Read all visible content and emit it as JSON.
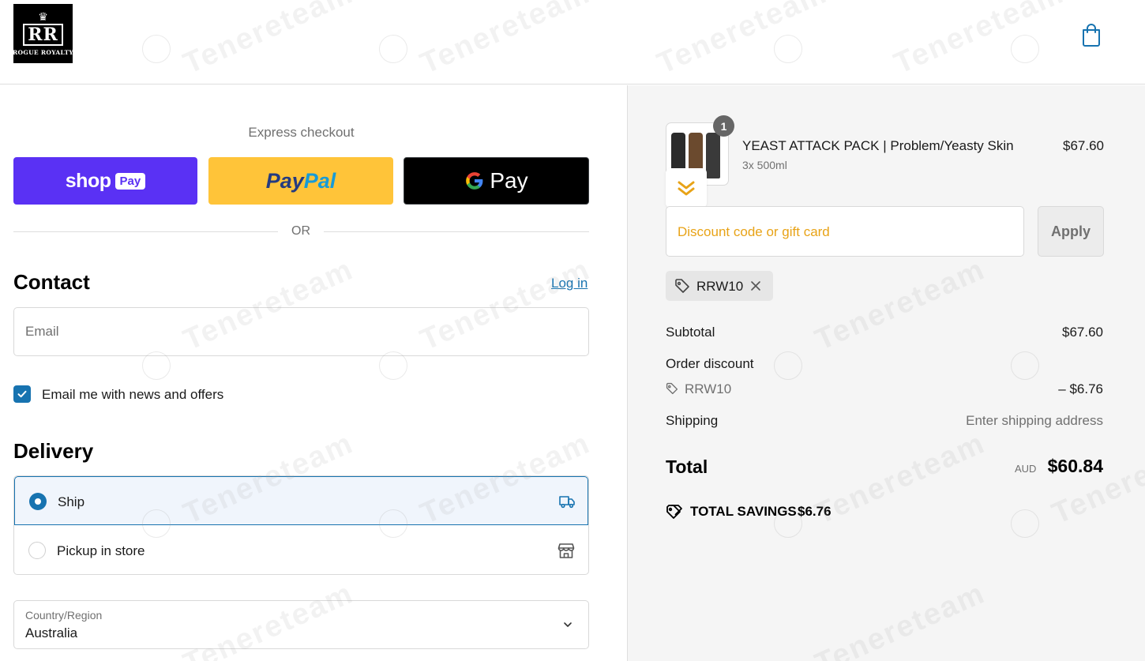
{
  "brand": {
    "logo_monogram": "RR",
    "logo_text": "ROGUE ROYALTY"
  },
  "watermark": {
    "text": "Tenereteam"
  },
  "express": {
    "label": "Express checkout",
    "shop_pay_word": "shop",
    "shop_pay_badge": "Pay",
    "paypal_part1": "Pay",
    "paypal_part2": "Pal",
    "gpay_word": "Pay",
    "or_label": "OR"
  },
  "contact": {
    "title": "Contact",
    "login_label": "Log in",
    "email_placeholder": "Email",
    "newsletter_label": "Email me with news and offers",
    "newsletter_checked": true
  },
  "delivery": {
    "title": "Delivery",
    "options": [
      {
        "label": "Ship",
        "selected": true,
        "icon": "truck-icon"
      },
      {
        "label": "Pickup in store",
        "selected": false,
        "icon": "store-icon"
      }
    ],
    "country_label": "Country/Region",
    "country_value": "Australia"
  },
  "order": {
    "product": {
      "name": "YEAST ATTACK PACK | Problem/Yeasty Skin",
      "variant": "3x 500ml",
      "price": "$67.60",
      "quantity": "1"
    },
    "discount": {
      "placeholder": "Discount code or gift card",
      "apply_label": "Apply",
      "applied_code": "RRW10"
    },
    "summary": {
      "subtotal_label": "Subtotal",
      "subtotal_value": "$67.60",
      "discount_label": "Order discount",
      "discount_code": "RRW10",
      "discount_value": "– $6.76",
      "shipping_label": "Shipping",
      "shipping_value": "Enter shipping address",
      "total_label": "Total",
      "total_currency": "AUD",
      "total_value": "$60.84",
      "savings_label": "TOTAL SAVINGS",
      "savings_value": "$6.76"
    }
  },
  "colors": {
    "accent": "#1773b0",
    "shop_pay": "#5a31f4",
    "paypal": "#ffc439",
    "gpay": "#000000",
    "summary_bg": "#f5f5f5",
    "discount_placeholder": "#e8a317"
  }
}
